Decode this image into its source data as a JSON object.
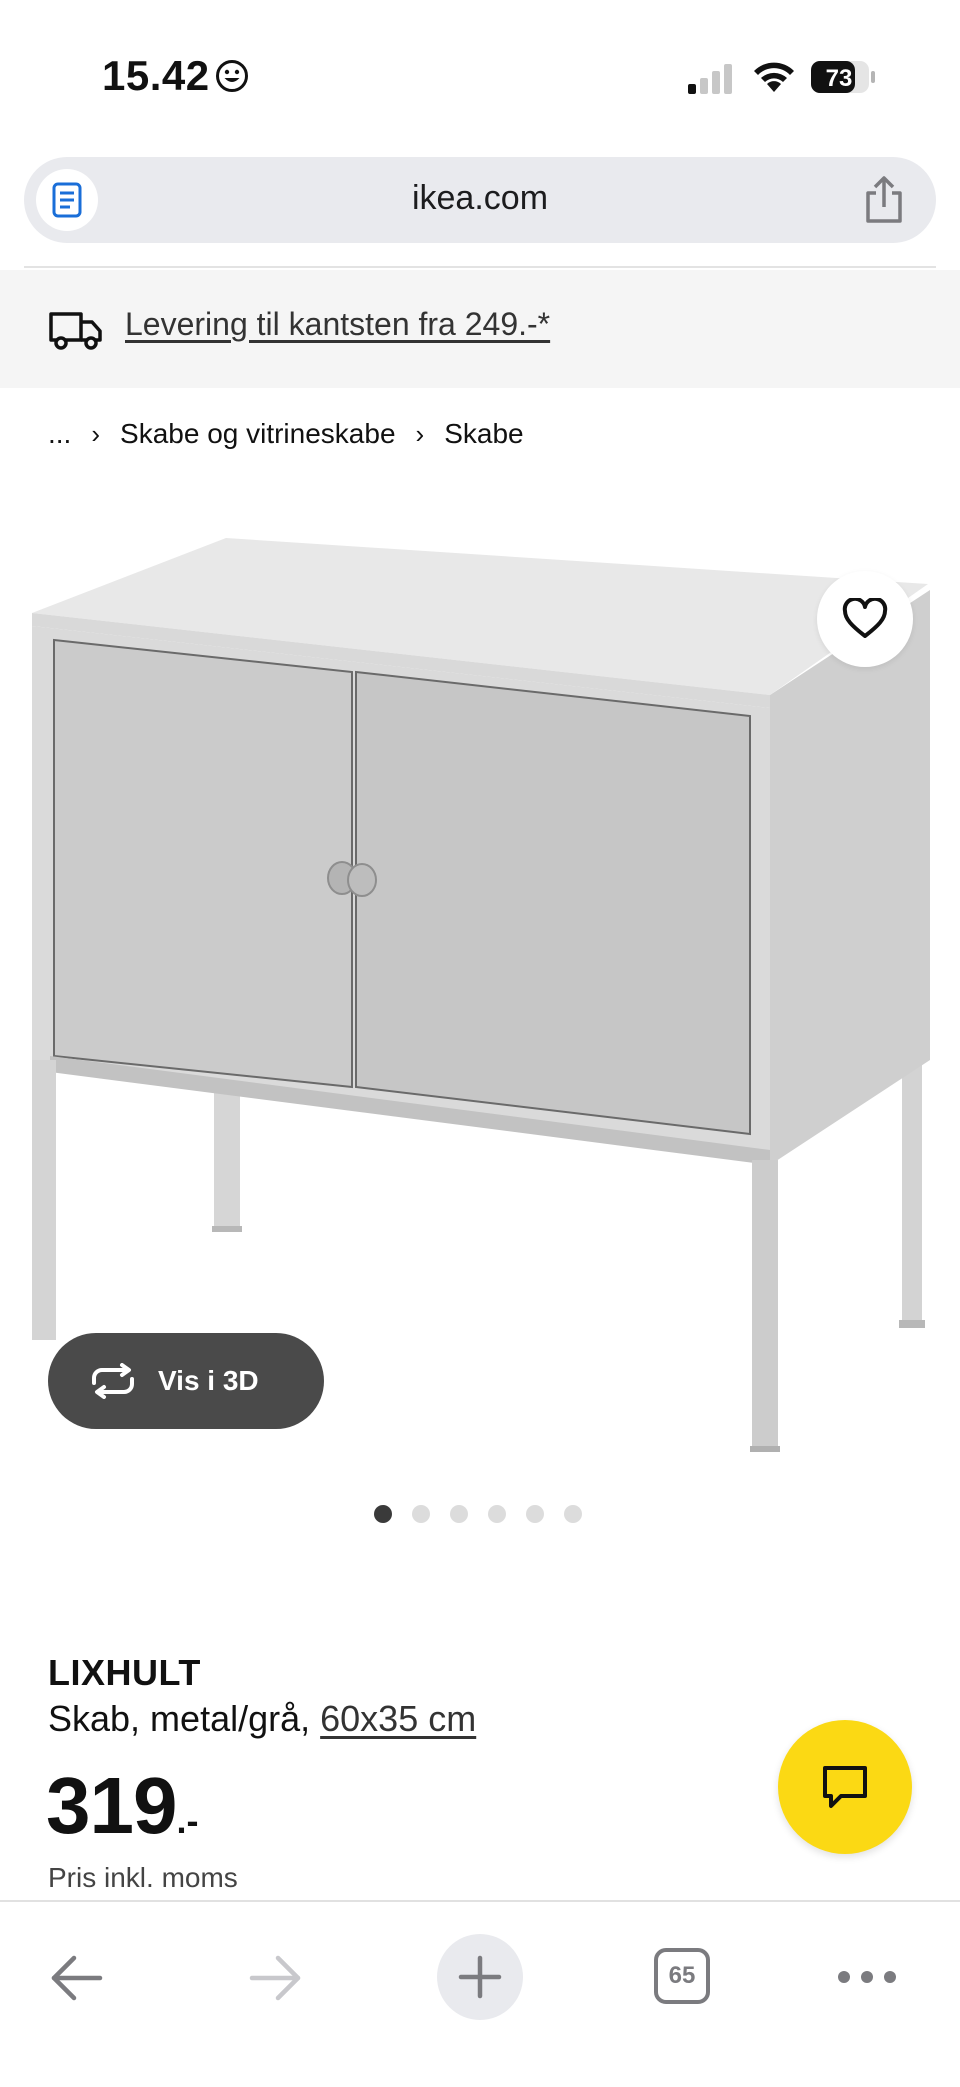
{
  "status_bar": {
    "time": "15.42",
    "battery": "73"
  },
  "browser": {
    "url": "ikea.com"
  },
  "delivery_banner": {
    "text": "Levering til kantsten fra 249.-*"
  },
  "breadcrumb": {
    "ellipsis": "...",
    "items": [
      "Skabe og vitrineskabe",
      "Skabe"
    ]
  },
  "gallery": {
    "view_3d_label": "Vis i 3D",
    "image_count": 6,
    "active_index": 0
  },
  "product": {
    "name": "LIXHULT",
    "description": "Skab, metal/grå, ",
    "size": "60x35 cm",
    "price": "319",
    "price_suffix": ".-",
    "price_note": "Pris inkl. moms"
  },
  "toolbar": {
    "tab_count": "65"
  },
  "colors": {
    "chat_button": "#fbd914",
    "view_3d_button": "#4a4a4a",
    "banner_bg": "#f5f5f5"
  },
  "icons": [
    "smiley-icon",
    "signal-icon",
    "wifi-icon",
    "battery-icon",
    "reader-icon",
    "share-icon",
    "truck-icon",
    "heart-icon",
    "rotate-3d-icon",
    "chat-icon",
    "back-arrow-icon",
    "forward-arrow-icon",
    "plus-icon",
    "tabs-icon",
    "more-icon"
  ]
}
